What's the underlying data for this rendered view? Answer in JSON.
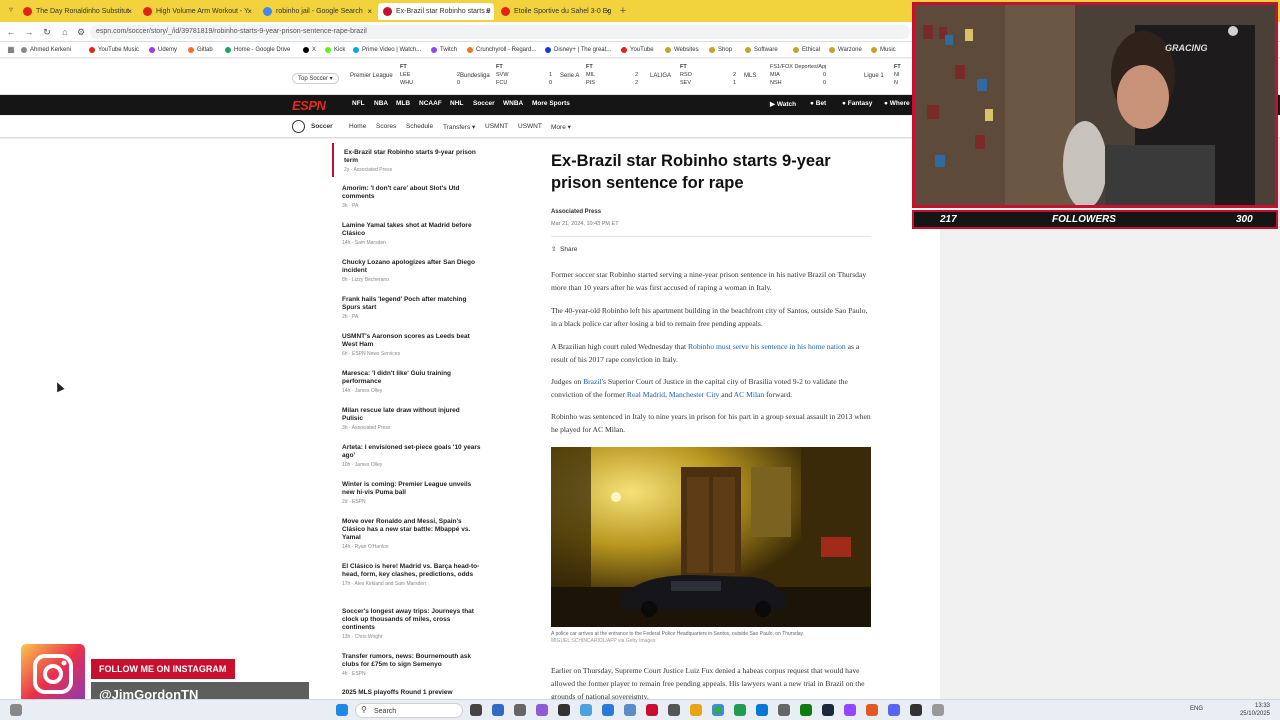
{
  "browser": {
    "tabs": [
      {
        "label": "The Day Ronaldinho Substitut",
        "color": "#e62117"
      },
      {
        "label": "High Volume Arm Workout - Y",
        "color": "#e62117"
      },
      {
        "label": "robinho jail - Google Search",
        "color": "#4285f4"
      },
      {
        "label": "Ex-Brazil star Robinho starts 9",
        "color": "#c8102e"
      },
      {
        "label": "Etoile Sportive du Sahel 3-0 Eg",
        "color": "#e62117"
      }
    ],
    "url": "espn.com/soccer/story/_/id/39781819/robinho-starts-9-year-prison-sentence-rape-brazil",
    "bookmarks": [
      "Ahmed Kerkeni",
      "YouTube Music",
      "Udemy",
      "Gitlab",
      "Home - Google Drive",
      "X",
      "Kick",
      "Prime Video | Watch...",
      "Twitch",
      "Crunchyroll - Regard...",
      "Disney+ | The great...",
      "YouTube",
      "Websites",
      "Shop",
      "Software",
      "Ethical",
      "Warzone",
      "Music"
    ]
  },
  "scorebar": {
    "top_label": "Top Soccer",
    "leagues": [
      {
        "name": "Premier League"
      },
      {
        "name": "Bundesliga"
      },
      {
        "name": "Serie A"
      },
      {
        "name": "LALIGA"
      },
      {
        "name": "MLS"
      },
      {
        "name": "Ligue 1"
      }
    ],
    "games": [
      {
        "status": "FT",
        "t1": "LEE",
        "s1": "2",
        "t2": "WHU",
        "s2": "0"
      },
      {
        "status": "FT",
        "t1": "SVW",
        "s1": "1",
        "t2": "FCU",
        "s2": "0"
      },
      {
        "status": "FT",
        "t1": "MIL",
        "s1": "2",
        "t2": "PIS",
        "s2": "2"
      },
      {
        "status": "FT",
        "t1": "RSO",
        "s1": "2",
        "t2": "SEV",
        "s2": "1"
      },
      {
        "status": "FS1/FOX Deportes/Apple TV+",
        "t1": "MIA",
        "s1": "0",
        "t2": "NSH",
        "s2": "0"
      },
      {
        "status": "FT",
        "t1": "NI",
        "s1": "",
        "t2": "N",
        "s2": ""
      }
    ]
  },
  "espn_nav": {
    "logo": "ESPN",
    "items": [
      "NFL",
      "NBA",
      "MLB",
      "NCAAF",
      "NHL",
      "Soccer",
      "WNBA",
      "More Sports"
    ],
    "right": [
      "Watch",
      "Bet",
      "Fantasy",
      "Where"
    ]
  },
  "subnav": {
    "section": "Soccer",
    "items": [
      "Home",
      "Scores",
      "Schedule",
      "Transfers",
      "USMNT",
      "USWNT",
      "More"
    ]
  },
  "sidebar": {
    "items": [
      {
        "title": "Ex-Brazil star Robinho starts 9-year prison term",
        "meta": "2y · Associated Press"
      },
      {
        "title": "Amorim: 'I don't care' about Slot's Utd comments",
        "meta": "3h · PA"
      },
      {
        "title": "Lamine Yamal takes shot at Madrid before Clásico",
        "meta": "14h · Sam Marsden"
      },
      {
        "title": "Chucky Lozano apologizes after San Diego incident",
        "meta": "8h · Lizzy Becherano"
      },
      {
        "title": "Frank hails 'legend' Poch after matching Spurs start",
        "meta": "2h · PA"
      },
      {
        "title": "USMNT's Aaronson scores as Leeds beat West Ham",
        "meta": "6h · ESPN News Services"
      },
      {
        "title": "Maresca: 'I didn't like' Guiu training performance",
        "meta": "14h · James Olley"
      },
      {
        "title": "Milan rescue late draw without injured Pulisic",
        "meta": "3h · Associated Press"
      },
      {
        "title": "Arteta: I envisioned set-piece goals '10 years ago'",
        "meta": "10h · James Olley"
      },
      {
        "title": "Winter is coming: Premier League unveils new hi-vis Puma ball",
        "meta": "2d · ESPN"
      },
      {
        "title": "Move over Ronaldo and Messi, Spain's Clásico has a new star battle: Mbappé vs. Yamal",
        "meta": "14h · Ryan O'Hanlon"
      },
      {
        "title": "El Clásico is here! Madrid vs. Barça head-to-head, form, key clashes, predictions, odds",
        "meta": "17h · Alex Kirkland and Sam Marsden"
      },
      {
        "title": "Soccer's longest away trips: Journeys that clock up thousands of miles, cross continents",
        "meta": "13h · Chris Wright"
      },
      {
        "title": "Transfer rumors, news: Bournemouth ask clubs for £75m to sign Semenyo",
        "meta": "4h · ESPN"
      },
      {
        "title": "2025 MLS playoffs Round 1 preview",
        "meta": ""
      }
    ]
  },
  "article": {
    "headline": "Ex-Brazil star Robinho starts 9-year prison sentence for rape",
    "byline": "Associated Press",
    "date": "Mar 21, 2024, 10:43 PM ET",
    "share": "Share",
    "p1": "Former soccer star Robinho started serving a nine-year prison sentence in his native Brazil on Thursday more than 10 years after he was first accused of raping a woman in Italy.",
    "p2": "The 40-year-old Robinho left his apartment building in the beachfront city of Santos, outside Sao Paulo, in a black police car after losing a bid to remain free pending appeals.",
    "p3a": "A Brazilian high court ruled Wednesday that ",
    "p3link": "Robinho must serve his sentence in his home nation",
    "p3b": " as a result of his 2017 rape conviction in Italy.",
    "p4a": "Judges on ",
    "p4link1": "Brazil",
    "p4b": "'s Superior Court of Justice in the capital city of Brasilia voted 9-2 to validate the conviction of the former ",
    "p4link2": "Real Madrid",
    "p4c": ", ",
    "p4link3": "Manchester City",
    "p4d": " and ",
    "p4link4": "AC Milan",
    "p4e": " forward.",
    "p5": "Robinho was sentenced in Italy to nine years in prison for his part in a group sexual assault in 2013 when he played for AC Milan.",
    "caption1": "A police car arrives at the entrance to the Federal Police Headquarters in Santos, outside Sao Paulo, on Thursday.",
    "caption2": "MIGUEL SCHINCARIOL/AFP via Getty Images",
    "p6": "Earlier on Thursday, Supreme Court Justice Luiz Fux denied a habeas corpus request that would have allowed the former player to remain free pending appeals. His lawyers want a new trial in Brazil on the grounds of national sovereignty."
  },
  "stream": {
    "follower_count": "217",
    "followers_label": "FOLLOWERS",
    "follower_goal": "300",
    "chair_brand": "GRACING",
    "instagram_cta": "FOLLOW ME ON INSTAGRAM",
    "instagram_handle": "@JimGordonTN"
  },
  "taskbar": {
    "search_placeholder": "Search",
    "lang": "ENG",
    "time": "13:33",
    "date": "25/10/2025"
  }
}
